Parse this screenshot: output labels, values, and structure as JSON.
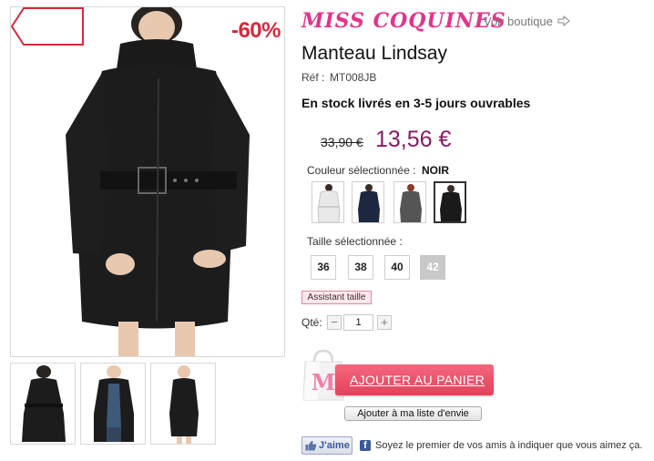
{
  "product_image": {
    "discount_badge": "-60%",
    "alt": "black coat photo"
  },
  "thumbnails": [
    {
      "icon": "coat-back-thumbnail"
    },
    {
      "icon": "coat-open-thumbnail"
    },
    {
      "icon": "coat-side-thumbnail"
    }
  ],
  "brand": {
    "logo_text": "MISS COQUINES",
    "store_link": "Voir boutique"
  },
  "product": {
    "title": "Manteau Lindsay",
    "ref_label": "Réf :",
    "ref_value": "MT008JB",
    "stock": "En stock livrés en 3-5 jours ouvrables",
    "old_price": "33,90 €",
    "new_price": "13,56 €"
  },
  "color": {
    "label": "Couleur sélectionnée :",
    "value": "NOIR",
    "swatches": [
      "white",
      "navy",
      "grey",
      "black"
    ],
    "selected_index": 3
  },
  "size": {
    "label": "Taille sélectionnée :",
    "options": [
      "36",
      "38",
      "40",
      "42"
    ],
    "disabled": [
      "42"
    ],
    "helper": "Assistant taille"
  },
  "quantity": {
    "label": "Qté:",
    "value": "1",
    "minus": "−",
    "plus": "+"
  },
  "actions": {
    "add_to_cart": "AJOUTER AU PANIER",
    "wishlist": "Ajouter à ma liste d'envie"
  },
  "social": {
    "like_label": "J'aime",
    "text": "Soyez le premier de vos amis à indiquer que vous aimez ça."
  },
  "colors": {
    "brand_pink": "#e4338a",
    "price_purple": "#8a1a63",
    "cart_red": "#e4415c",
    "badge_red": "#d42a3c",
    "facebook_blue": "#3b5998"
  }
}
